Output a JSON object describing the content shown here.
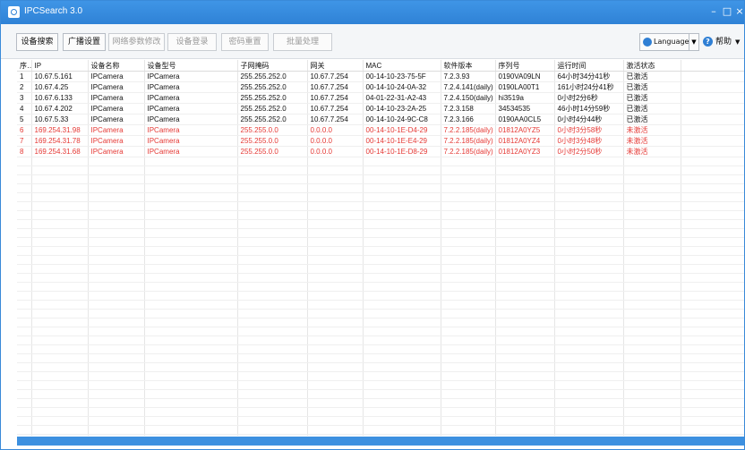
{
  "window": {
    "title": "IPCSearch 3.0"
  },
  "toolbar": {
    "buttons": [
      "设备搜索",
      "广播设置",
      "网络参数修改",
      "设备登录",
      "密码重置",
      "批量处理"
    ],
    "language_label": "Language",
    "help_label": "帮助"
  },
  "table": {
    "headers": [
      "序号",
      "IP",
      "设备名称",
      "设备型号",
      "子网掩码",
      "网关",
      "MAC",
      "软件版本",
      "序列号",
      "运行时间",
      "激活状态"
    ],
    "rows": [
      [
        "1",
        "10.67.5.161",
        "IPCamera",
        "IPCamera",
        "255.255.252.0",
        "10.67.7.254",
        "00-14-10-23-75-5F",
        "7.2.3.93",
        "0190VA09LN",
        "64小时34分41秒",
        "已激活"
      ],
      [
        "2",
        "10.67.4.25",
        "IPCamera",
        "IPCamera",
        "255.255.252.0",
        "10.67.7.254",
        "00-14-10-24-0A-32",
        "7.2.4.141(daily)",
        "0190LA00T1",
        "161小时24分41秒",
        "已激活"
      ],
      [
        "3",
        "10.67.6.133",
        "IPCamera",
        "IPCamera",
        "255.255.252.0",
        "10.67.7.254",
        "04-01-22-31-A2-43",
        "7.2.4.150(daily)",
        "hi3519a",
        "0小时2分6秒",
        "已激活"
      ],
      [
        "4",
        "10.67.4.202",
        "IPCamera",
        "IPCamera",
        "255.255.252.0",
        "10.67.7.254",
        "00-14-10-23-2A-25",
        "7.2.3.158",
        "34534535",
        "46小时14分59秒",
        "已激活"
      ],
      [
        "5",
        "10.67.5.33",
        "IPCamera",
        "IPCamera",
        "255.255.252.0",
        "10.67.7.254",
        "00-14-10-24-9C-C8",
        "7.2.3.166",
        "0190AA0CL5",
        "0小时4分44秒",
        "已激活"
      ],
      [
        "6",
        "169.254.31.98",
        "IPCamera",
        "IPCamera",
        "255.255.0.0",
        "0.0.0.0",
        "00-14-10-1E-D4-29",
        "7.2.2.185(daily)",
        "01812A0YZ5",
        "0小时3分58秒",
        "未激活"
      ],
      [
        "7",
        "169.254.31.78",
        "IPCamera",
        "IPCamera",
        "255.255.0.0",
        "0.0.0.0",
        "00-14-10-1E-E4-29",
        "7.2.2.185(daily)",
        "01812A0YZ4",
        "0小时3分48秒",
        "未激活"
      ],
      [
        "8",
        "169.254.31.68",
        "IPCamera",
        "IPCamera",
        "255.255.0.0",
        "0.0.0.0",
        "00-14-10-1E-D8-29",
        "7.2.2.185(daily)",
        "01812A0YZ3",
        "0小时2分50秒",
        "未激活"
      ]
    ]
  }
}
